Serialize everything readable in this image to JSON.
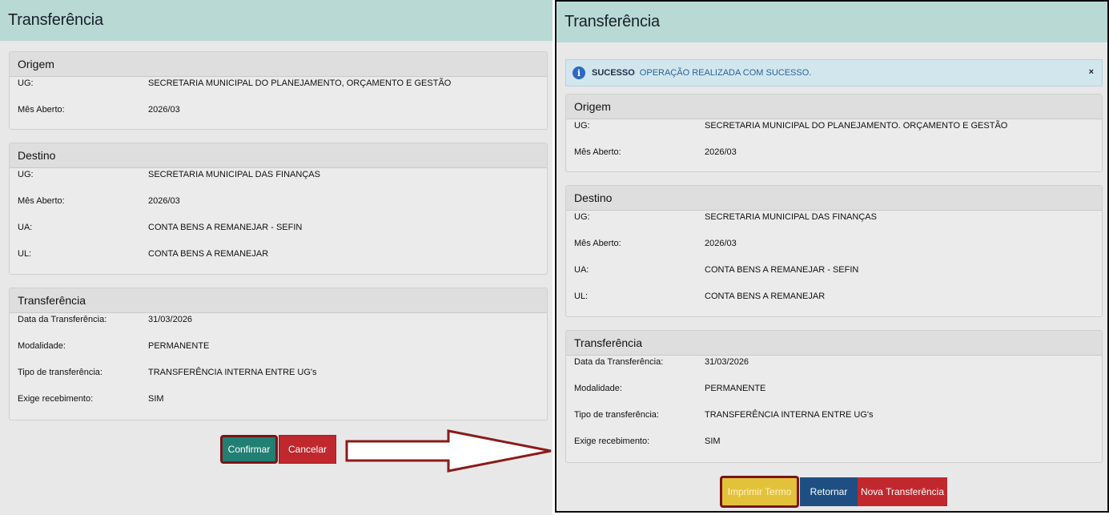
{
  "left": {
    "title": "Transferência",
    "origem": {
      "header": "Origem",
      "rows": [
        {
          "label": "UG:",
          "value": "SECRETARIA MUNICIPAL DO PLANEJAMENTO, ORÇAMENTO E GESTÃO"
        },
        {
          "label": "Mês Aberto:",
          "value": "2026/03"
        }
      ]
    },
    "destino": {
      "header": "Destino",
      "rows": [
        {
          "label": "UG:",
          "value": "SECRETARIA MUNICIPAL DAS FINANÇAS"
        },
        {
          "label": "Mês Aberto:",
          "value": "2026/03"
        },
        {
          "label": "UA:",
          "value": "CONTA BENS A REMANEJAR - SEFIN"
        },
        {
          "label": "UL:",
          "value": "CONTA BENS A REMANEJAR"
        }
      ]
    },
    "transferencia": {
      "header": "Transferência",
      "rows": [
        {
          "label": "Data da Transferência:",
          "value": "31/03/2026"
        },
        {
          "label": "Modalidade:",
          "value": "PERMANENTE"
        },
        {
          "label": "Tipo de transferência:",
          "value": "TRANSFERÊNCIA INTERNA ENTRE UG's"
        },
        {
          "label": "Exige recebimento:",
          "value": "SIM"
        }
      ]
    },
    "buttons": {
      "confirm": "Confirmar",
      "cancel": "Cancelar"
    }
  },
  "right": {
    "title": "Transferência",
    "alert": {
      "icon": "info-icon",
      "strong": "SUCESSO",
      "message": "OPERAÇÃO REALIZADA COM SUCESSO.",
      "close": "×"
    },
    "origem": {
      "header": "Origem",
      "rows": [
        {
          "label": "UG:",
          "value": "SECRETARIA MUNICIPAL DO PLANEJAMENTO. ORÇAMENTO E GESTÃO"
        },
        {
          "label": "Mês Aberto:",
          "value": "2026/03"
        }
      ]
    },
    "destino": {
      "header": "Destino",
      "rows": [
        {
          "label": "UG:",
          "value": "SECRETARIA MUNICIPAL DAS FINANÇAS"
        },
        {
          "label": "Mês Aberto:",
          "value": "2026/03"
        },
        {
          "label": "UA:",
          "value": "CONTA BENS A REMANEJAR - SEFIN"
        },
        {
          "label": "UL:",
          "value": "CONTA BENS A REMANEJAR"
        }
      ]
    },
    "transferencia": {
      "header": "Transferência",
      "rows": [
        {
          "label": "Data da Transferência:",
          "value": "31/03/2026"
        },
        {
          "label": "Modalidade:",
          "value": "PERMANENTE"
        },
        {
          "label": "Tipo de transferência:",
          "value": "TRANSFERÊNCIA INTERNA ENTRE UG's"
        },
        {
          "label": "Exige recebimento:",
          "value": "SIM"
        }
      ]
    },
    "buttons": {
      "print": "Imprimir Termo",
      "back": "Retornar",
      "new": "Nova Transferência"
    }
  },
  "colors": {
    "title_bar": "#b9d9d4",
    "confirm": "#217f74",
    "cancel": "#c0282e",
    "print": "#e3c23b",
    "back": "#1f4f82",
    "new": "#c0282e",
    "highlight_border": "#7b1515"
  }
}
